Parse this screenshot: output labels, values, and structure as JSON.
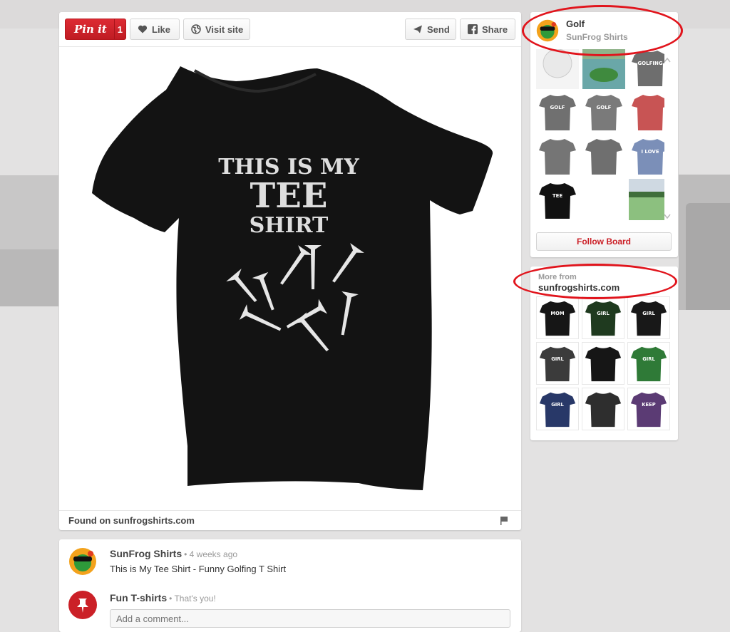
{
  "toolbar": {
    "pinit_label": "Pin it",
    "pinit_count": "1",
    "like_label": "Like",
    "visit_label": "Visit site",
    "send_label": "Send",
    "share_label": "Share"
  },
  "product": {
    "shirt_line1": "THIS IS MY",
    "shirt_line2": "TEE",
    "shirt_line3": "SHIRT"
  },
  "found_on": "Found on sunfrogshirts.com",
  "comments": {
    "author": "SunFrog Shirts",
    "author_time": "• 4 weeks ago",
    "description": "This is My Tee Shirt - Funny Golfing T Shirt",
    "viewer": "Fun T-shirts",
    "viewer_note": "• That's you!",
    "input_placeholder": "Add a comment..."
  },
  "board": {
    "title": "Golf",
    "owner": "SunFrog Shirts",
    "follow_label": "Follow Board",
    "thumbs": [
      {
        "kind": "ball",
        "color": "#e9e9e9"
      },
      {
        "kind": "green",
        "color": "#6aa7a8"
      },
      {
        "kind": "shirt",
        "color": "#6e6e6e",
        "text": "GOLFING"
      },
      {
        "kind": "shirt",
        "color": "#707070",
        "text": "GOLF"
      },
      {
        "kind": "shirt",
        "color": "#7a7a7a",
        "text": "GOLF"
      },
      {
        "kind": "shirt",
        "color": "#c85454",
        "text": ""
      },
      {
        "kind": "shirt",
        "color": "#757575",
        "text": ""
      },
      {
        "kind": "shirt",
        "color": "#6f6f6f",
        "text": ""
      },
      {
        "kind": "shirt",
        "color": "#7b8fb8",
        "text": "I LOVE"
      },
      {
        "kind": "shirt",
        "color": "#111111",
        "text": "TEE"
      },
      {
        "kind": "empty",
        "color": "#ffffff"
      },
      {
        "kind": "course",
        "color": "#7fb07a"
      }
    ]
  },
  "more_from": {
    "label": "More from",
    "domain": "sunfrogshirts.com",
    "thumbs": [
      {
        "color": "#161616",
        "text": "MOM"
      },
      {
        "color": "#1f3a1f",
        "text": "GIRL"
      },
      {
        "color": "#181818",
        "text": "GIRL"
      },
      {
        "color": "#3b3b3b",
        "text": "GIRL"
      },
      {
        "color": "#161616",
        "text": ""
      },
      {
        "color": "#2f7a37",
        "text": "GIRL"
      },
      {
        "color": "#283868",
        "text": "GIRL"
      },
      {
        "color": "#2e2e2e",
        "text": ""
      },
      {
        "color": "#5b3b74",
        "text": "KEEP"
      }
    ]
  },
  "colors": {
    "pin_red": "#cb2027",
    "annotation_red": "#e1141c",
    "shirt_black": "#131313"
  },
  "icons": [
    "heart-icon",
    "globe-icon",
    "send-icon",
    "facebook-icon",
    "flag-icon",
    "pushpin-icon",
    "frog-logo-icon"
  ]
}
